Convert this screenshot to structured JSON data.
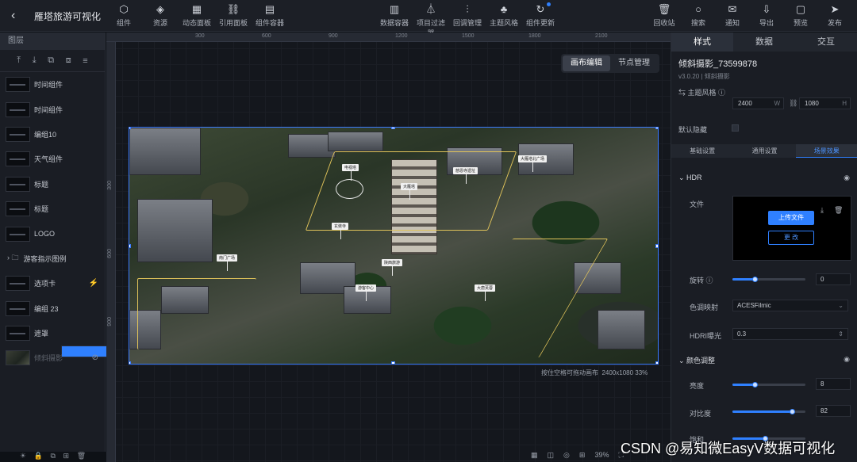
{
  "header": {
    "title": "雁塔旅游可视化",
    "back_icon": "‹",
    "left_tools": [
      {
        "label": "组件",
        "icon": "⬡"
      },
      {
        "label": "资源",
        "icon": "◈"
      },
      {
        "label": "动态面板",
        "icon": "▦"
      },
      {
        "label": "引用面板",
        "icon": "⛓"
      },
      {
        "label": "组件容器",
        "icon": "▤"
      }
    ],
    "mid_tools": [
      {
        "label": "数据容器",
        "icon": "▥"
      },
      {
        "label": "项目过滤器",
        "icon": "⏃"
      },
      {
        "label": "回调管理",
        "icon": "⫶"
      },
      {
        "label": "主题风格",
        "icon": "♣"
      },
      {
        "label": "组件更新",
        "icon": "↻"
      }
    ],
    "right_tools": [
      {
        "label": "回收站",
        "icon": "🗑"
      },
      {
        "label": "搜索",
        "icon": "○"
      },
      {
        "label": "通知",
        "icon": "✉"
      },
      {
        "label": "导出",
        "icon": "⇩"
      },
      {
        "label": "预览",
        "icon": "▢"
      },
      {
        "label": "发布",
        "icon": "➤"
      }
    ]
  },
  "left_panel": {
    "header": "图层",
    "tools": [
      "⤒",
      "⤓",
      "⧉",
      "⧈",
      "≡"
    ],
    "layers": [
      {
        "label": "时间组件"
      },
      {
        "label": "时间组件"
      },
      {
        "label": "编组10"
      },
      {
        "label": "天气组件"
      },
      {
        "label": "标题"
      },
      {
        "label": "标题"
      },
      {
        "label": "LOGO"
      },
      {
        "label": "游客指示图例",
        "folder": true
      },
      {
        "label": "选项卡",
        "flag": "⚡"
      },
      {
        "label": "编组 23"
      },
      {
        "label": "遮罩"
      },
      {
        "label": "倾斜摄影",
        "selected": true
      },
      {
        "label": "倾斜摄影",
        "dim": true,
        "flag": "⊘"
      }
    ],
    "bottom_icons": [
      "☀",
      "🔒",
      "⧉",
      "⊞",
      "🗑"
    ]
  },
  "canvas": {
    "tabs": [
      "画布编辑",
      "节点管理"
    ],
    "active_tab": "画布编辑",
    "hruler": [
      "300",
      "600",
      "900",
      "1200",
      "1500",
      "1800",
      "2100"
    ],
    "vruler": [
      "300",
      "600",
      "900"
    ],
    "hint": "按住空格可拖动画布",
    "size": "2400x1080 33%",
    "bottom": [
      "▦",
      "◫",
      "◎",
      "⊞",
      "39%",
      "⛶"
    ],
    "tags": [
      "电视塔",
      "大雁塔",
      "慈恩寺遗址",
      "大雁塔北广场",
      "玄奘寺",
      "南门广场",
      "陕西旅游",
      "游客中心",
      "大唐芙蓉"
    ]
  },
  "right_panel": {
    "tabs": [
      "样式",
      "数据",
      "交互"
    ],
    "active_tab": "样式",
    "component_name": "倾斜摄影_73599878",
    "version": "v3.0.20 | 倾斜摄影",
    "theme_label": "主题风格 ⓘ",
    "width": "2400",
    "width_unit": "W",
    "height": "1080",
    "height_unit": "H",
    "default_hidden": "默认隐藏",
    "subtabs": [
      "基础设置",
      "通用设置",
      "场景效果"
    ],
    "active_subtab": "场景效果",
    "hdr_section": "HDR",
    "file_label": "文件",
    "upload_btn": "上传文件",
    "change_btn": "更 改",
    "rotate_label": "旋转 ⓘ",
    "rotate_value": "0",
    "rotate_level": 0.3,
    "tonemap_label": "色调映射",
    "tonemap_value": "ACESFilmic",
    "hdr_exposure_label": "HDRI曝光",
    "hdr_exposure_value": "0.3",
    "color_section": "颜色调整",
    "brightness_label": "亮度",
    "brightness_value": "8",
    "brightness_level": 0.3,
    "contrast_label": "对比度",
    "contrast_value": "82",
    "contrast_level": 0.82,
    "saturation_label": "饱和",
    "saturation_level": 0.45
  },
  "watermark": "CSDN @易知微EasyV数据可视化",
  "colors": {
    "accent": "#2f80ff",
    "panel": "#1a1d24",
    "topbar": "#1c1f26"
  }
}
